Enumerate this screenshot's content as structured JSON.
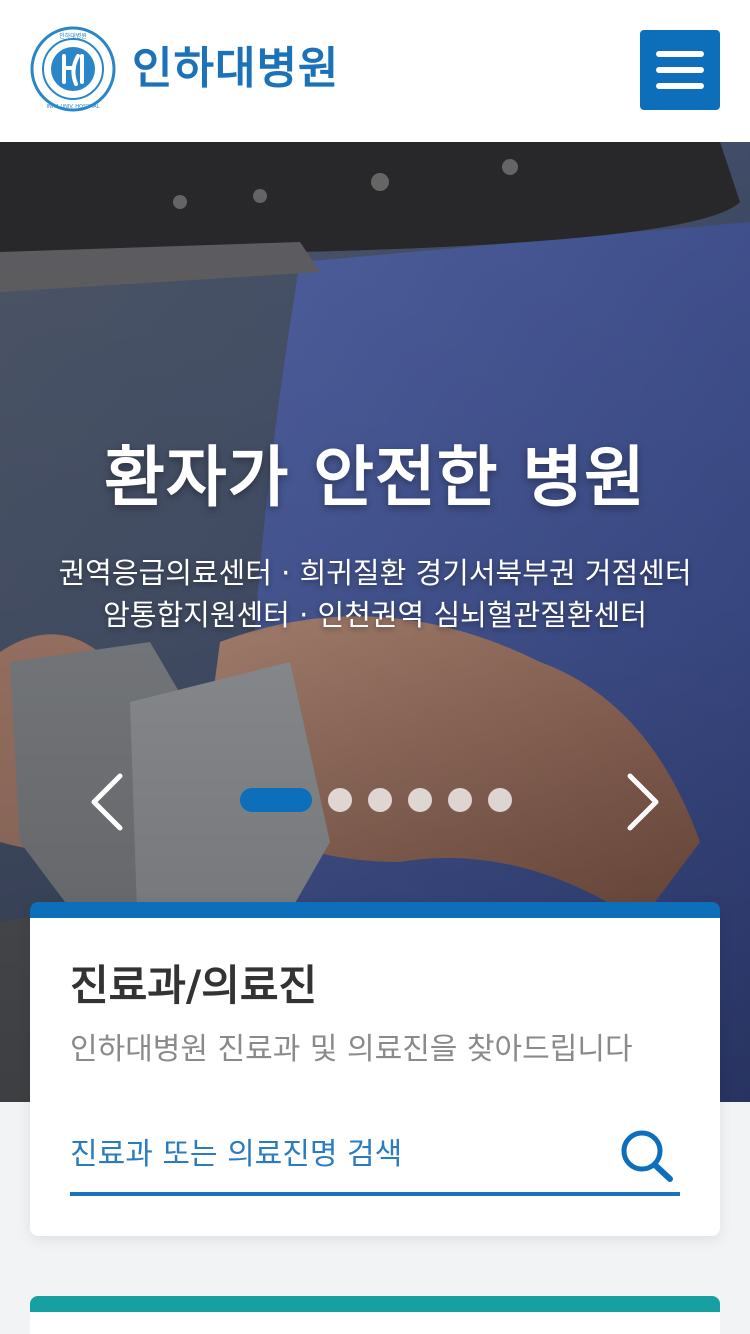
{
  "header": {
    "logo_text": "인하대병원",
    "emblem_top_text": "인하대병원",
    "emblem_bottom_text": "INHA UNIV. HOSPITAL",
    "menu_label": "메뉴"
  },
  "hero": {
    "title": "환자가 안전한 병원",
    "subtitle_line1": "권역응급의료센터 · 희귀질환 경기서북부권 거점센터",
    "subtitle_line2": "암통합지원센터 · 인천권역 심뇌혈관질환센터",
    "slide_count": 6,
    "active_slide": 1
  },
  "search_card": {
    "title": "진료과/의료진",
    "description": "인하대병원 진료과 및 의료진을 찾아드립니다",
    "input_placeholder": "진료과 또는 의료진명 검색",
    "input_value": "",
    "accent_color": "#0d6fba"
  },
  "next_card": {
    "accent_color": "#17a0a2"
  },
  "colors": {
    "brand": "#1b72b8",
    "primary": "#0d6fba"
  }
}
